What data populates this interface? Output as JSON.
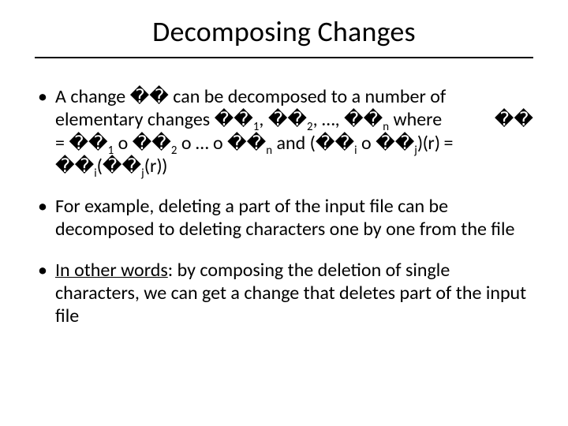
{
  "title": "Decomposing Changes",
  "bullets": {
    "b1": {
      "a": "A change ",
      "sym_c": "��",
      "b": " can be decomposed to a number of elementary changes ",
      "s1": "��",
      "sub1": "1",
      "c1": ", ",
      "s2": "��",
      "sub2": "2",
      "c2": ", …, ",
      "sn": "��",
      "subn": "n",
      "d": " where ",
      "eq_lhs": "��",
      "eq_eq": " = ",
      "t1": "��",
      "tsub1": "1",
      "o1": " o ",
      "t2": "��",
      "tsub2": "2",
      "o2": " o … o ",
      "tn": "��",
      "tsubn": "n",
      "and": " and (",
      "ci": "��",
      "csubi": "i",
      "o3": " o ",
      "cj": "��",
      "csubj": "j",
      "pr": ")(",
      "r1": "r",
      "rp": ") = ",
      "di": "��",
      "dsubi": "i",
      "lp": "(",
      "dj": "��",
      "dsubj": "j",
      "lp2": "(",
      "r2": "r",
      "tail": "))"
    },
    "b2": "For example, deleting a part of the input file can be decomposed to deleting characters one by one from the file",
    "b3_lead": "In other words",
    "b3_rest": ": by composing the deletion of single characters, we can get a change that deletes part of the input file"
  }
}
